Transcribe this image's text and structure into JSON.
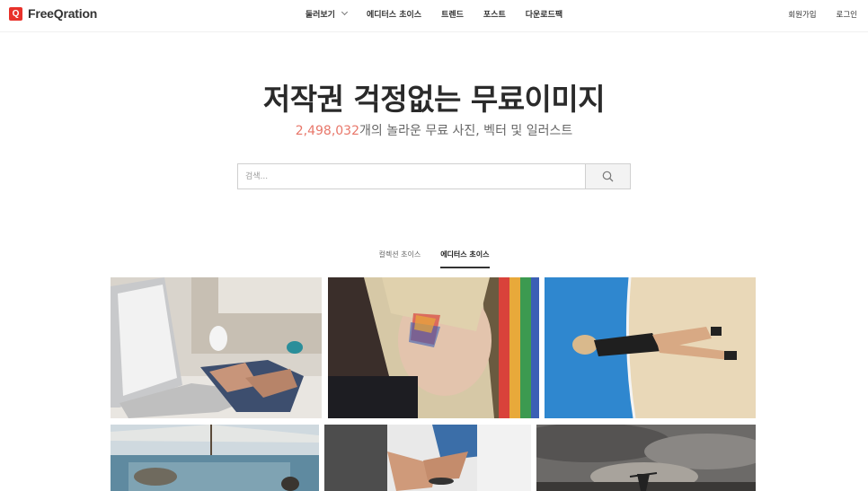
{
  "header": {
    "logo_letter": "Q",
    "logo_text": "FreeQration",
    "nav": [
      {
        "label": "둘러보기",
        "has_dropdown": true
      },
      {
        "label": "에디터스 초이스"
      },
      {
        "label": "트렌드"
      },
      {
        "label": "포스트"
      },
      {
        "label": "다운로드팩"
      }
    ],
    "signup": "회원가입",
    "login": "로그인"
  },
  "hero": {
    "title": "저작권 걱정없는 무료이미지",
    "count": "2,498,032",
    "subtitle_rest": "개의 놀라운 무료 사진, 벡터 및 일러스트"
  },
  "search": {
    "placeholder": "검색..."
  },
  "tabs": [
    {
      "label": "컬렉션 초이스",
      "active": false
    },
    {
      "label": "에디터스 초이스",
      "active": true
    }
  ],
  "colors": {
    "brand": "#e8312a",
    "count": "#e8776a"
  }
}
